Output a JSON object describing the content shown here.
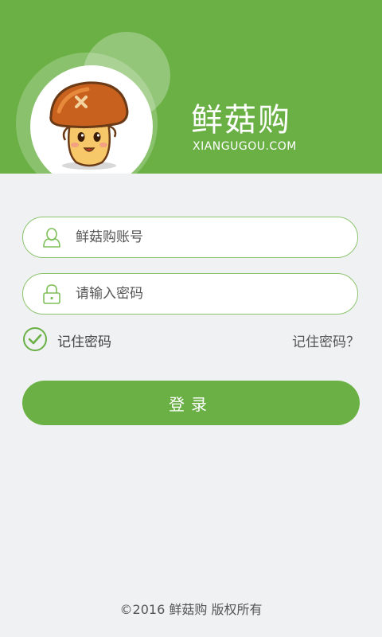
{
  "header": {
    "brand_name": "鲜菇购",
    "brand_domain": "XIANGUGOU.COM",
    "logo_icon": "mushroom-mascot",
    "background_color": "#6ab045"
  },
  "login_form": {
    "account": {
      "placeholder": "鲜菇购账号",
      "value": "",
      "icon": "user-icon"
    },
    "password": {
      "placeholder": "请输入密码",
      "value": "",
      "icon": "lock-icon"
    },
    "remember": {
      "label": "记住密码",
      "checked": true,
      "icon": "checkmark-circle-icon"
    },
    "forgot_label": "记住密码？",
    "submit_label": "登录"
  },
  "footer": {
    "copyright": "©2016 鲜菇购 版权所有"
  },
  "colors": {
    "accent": "#6ab045",
    "field_border": "#8cc46e",
    "page_bg": "#f0f1f3"
  }
}
